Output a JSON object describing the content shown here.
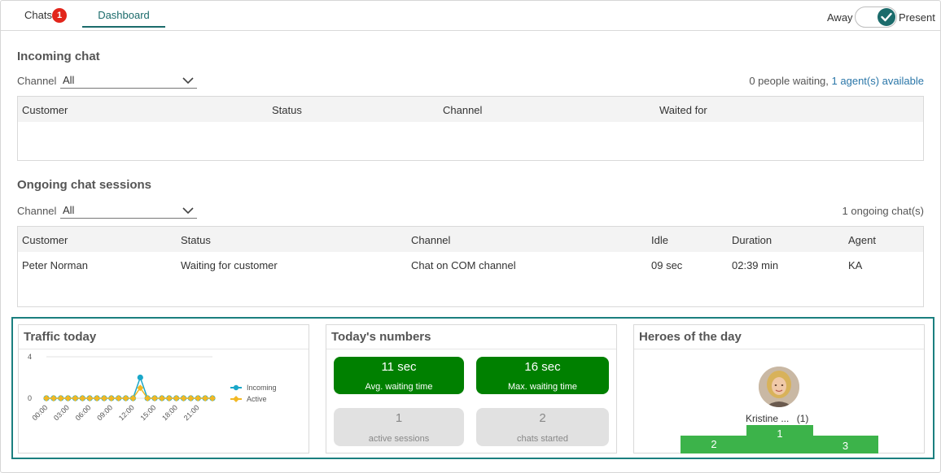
{
  "header": {
    "tabs": [
      {
        "label": "Chats",
        "badge": "1"
      },
      {
        "label": "Dashboard"
      }
    ],
    "status_toggle": {
      "off_label": "Away",
      "on_label": "Present",
      "state": "Present"
    }
  },
  "incoming": {
    "title": "Incoming chat",
    "channel_label": "Channel",
    "channel_value": "All",
    "waiting_text": "0 people waiting,",
    "agents_text": "1 agent(s) available",
    "columns": [
      "Customer",
      "Status",
      "Channel",
      "Waited for"
    ]
  },
  "ongoing": {
    "title": "Ongoing chat sessions",
    "channel_label": "Channel",
    "channel_value": "All",
    "count_text": "1 ongoing chat(s)",
    "columns": [
      "Customer",
      "Status",
      "Channel",
      "Idle",
      "Duration",
      "Agent"
    ],
    "rows": [
      [
        "Peter Norman",
        "Waiting for customer",
        "Chat on COM channel",
        "09 sec",
        "02:39 min",
        "KA"
      ]
    ]
  },
  "traffic": {
    "title": "Traffic today",
    "legend_incoming": "Incoming",
    "legend_active": "Active",
    "colors": {
      "incoming": "#1aa7c9",
      "active": "#f2b824"
    }
  },
  "chart_data": {
    "type": "line",
    "title": "",
    "x": [
      "00:00",
      "01:00",
      "02:00",
      "03:00",
      "04:00",
      "05:00",
      "06:00",
      "07:00",
      "08:00",
      "09:00",
      "10:00",
      "11:00",
      "12:00",
      "13:00",
      "14:00",
      "15:00",
      "16:00",
      "17:00",
      "18:00",
      "19:00",
      "20:00",
      "21:00",
      "22:00",
      "23:00"
    ],
    "tick_labels": [
      "00:00",
      "03:00",
      "06:00",
      "09:00",
      "12:00",
      "15:00",
      "18:00",
      "21:00"
    ],
    "ytick_labels": [
      "4",
      "0"
    ],
    "ylim": [
      0,
      4
    ],
    "series": [
      {
        "name": "Incoming",
        "values": [
          0,
          0,
          0,
          0,
          0,
          0,
          0,
          0,
          0,
          0,
          0,
          0,
          0,
          2,
          0,
          0,
          0,
          0,
          0,
          0,
          0,
          0,
          0,
          0
        ]
      },
      {
        "name": "Active",
        "values": [
          0,
          0,
          0,
          0,
          0,
          0,
          0,
          0,
          0,
          0,
          0,
          0,
          0,
          1,
          0,
          0,
          0,
          0,
          0,
          0,
          0,
          0,
          0,
          0
        ]
      }
    ],
    "legend": "right"
  },
  "numbers": {
    "title": "Today's numbers",
    "avg_value": "11 sec",
    "avg_label": "Avg. waiting time",
    "max_value": "16 sec",
    "max_label": "Max. waiting time",
    "active_value": "1",
    "active_label": "active sessions",
    "started_value": "2",
    "started_label": "chats started"
  },
  "heroes": {
    "title": "Heroes of the day",
    "top_name": "Kristine ...",
    "top_count": "(1)",
    "ranks": [
      "2",
      "1",
      "3"
    ]
  }
}
